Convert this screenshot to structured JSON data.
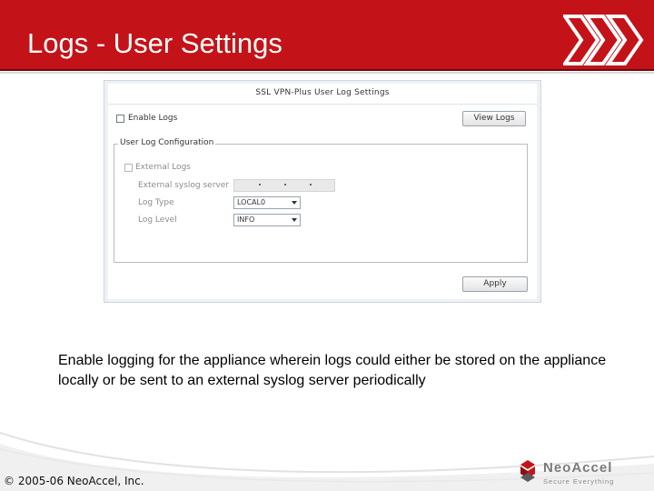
{
  "slide": {
    "title": "Logs - User Settings",
    "description": "Enable logging for the appliance wherein logs could either be stored on the appliance locally or be sent to an external syslog server periodically",
    "copyright": "© 2005-06 NeoAccel, Inc.",
    "logo": {
      "name": "NeoAccel",
      "tagline": "Secure Everything"
    },
    "colors": {
      "title_bar": "#c41318",
      "title_text": "#ffffff"
    }
  },
  "panel": {
    "title": "SSL VPN-Plus User Log Settings",
    "enable_logs": {
      "label": "Enable Logs",
      "checked": false
    },
    "view_logs_button": "View Logs",
    "config": {
      "legend": "User Log Configuration",
      "external_logs": {
        "label": "External Logs",
        "checked": false
      },
      "syslog_server_label": "External syslog server",
      "syslog_server_value": ". . .",
      "log_type_label": "Log Type",
      "log_type_value": "LOCAL0",
      "log_level_label": "Log Level",
      "log_level_value": "INFO"
    },
    "apply_button": "Apply"
  }
}
